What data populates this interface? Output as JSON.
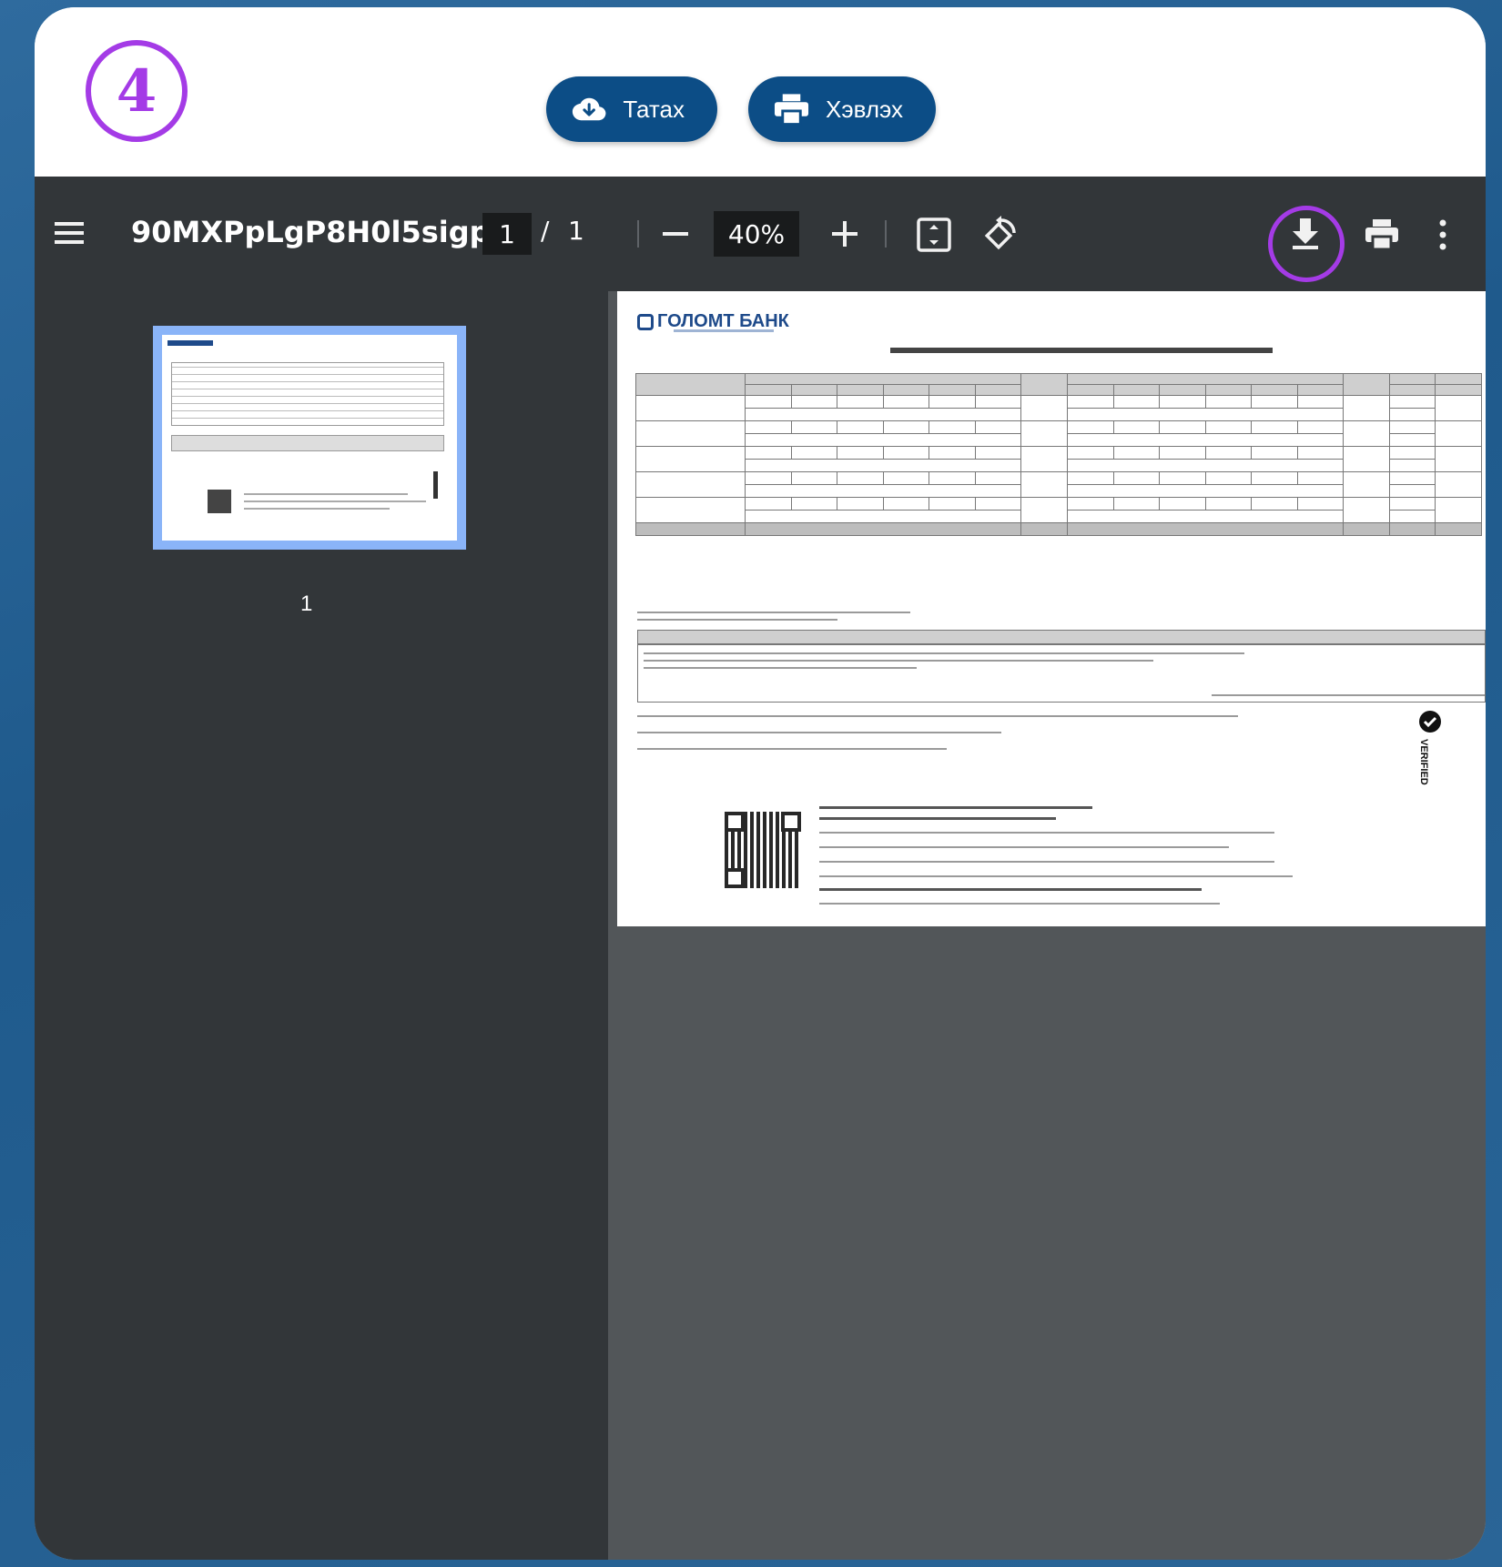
{
  "step": {
    "number": "4"
  },
  "actions": {
    "download_label": "Татах",
    "print_label": "Хэвлэх"
  },
  "viewer": {
    "file_name": "90MXPpLgP8H0l5sigpl...",
    "page_current": "1",
    "page_separator": "/",
    "page_total": "1",
    "zoom": "40%",
    "thumbnail_page_number": "1"
  },
  "document": {
    "bank_name": "ГОЛОМТ БАНК",
    "verified_label": "VERIFIED"
  },
  "colors": {
    "accent_purple": "#a43be6",
    "button_blue": "#0c4d86",
    "toolbar_bg": "#323639",
    "viewer_bg": "#525659"
  },
  "icons": [
    "cloud-download-icon",
    "printer-icon",
    "menu-icon",
    "minus-icon",
    "plus-icon",
    "fit-page-icon",
    "rotate-icon",
    "download-icon",
    "more-vert-icon"
  ]
}
